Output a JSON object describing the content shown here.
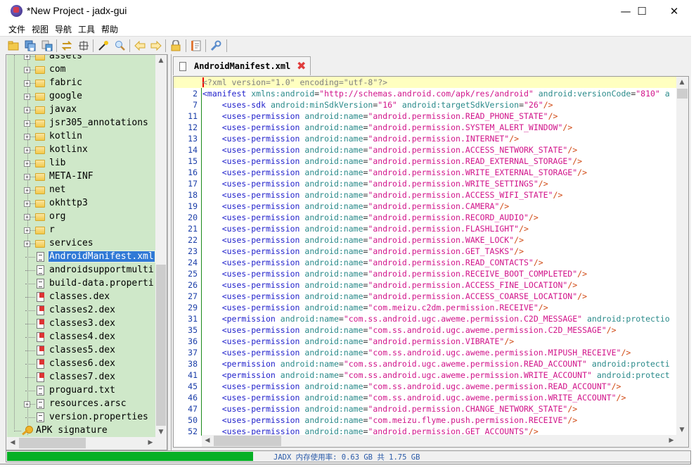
{
  "window": {
    "title": "*New Project - jadx-gui",
    "controls": {
      "minimize": "—",
      "maximize": "☐",
      "close": "✕"
    }
  },
  "menu": [
    "文件",
    "视图",
    "导航",
    "工具",
    "帮助"
  ],
  "toolbar": {
    "groups": [
      [
        "open-file-icon",
        "save-all-icon",
        "export-icon"
      ],
      [
        "sync-tree-icon",
        "flatten-packages-icon"
      ],
      [
        "decompile-all-icon",
        "search-icon"
      ],
      [
        "back-icon",
        "forward-icon"
      ],
      [
        "deobfuscation-icon"
      ],
      [
        "log-viewer-icon"
      ],
      [
        "preferences-icon"
      ]
    ]
  },
  "tree": {
    "items": [
      {
        "label": "assets",
        "type": "folder",
        "expandable": true
      },
      {
        "label": "com",
        "type": "folder",
        "expandable": true
      },
      {
        "label": "fabric",
        "type": "folder",
        "expandable": true
      },
      {
        "label": "google",
        "type": "folder",
        "expandable": true
      },
      {
        "label": "javax",
        "type": "folder",
        "expandable": true
      },
      {
        "label": "jsr305_annotations",
        "type": "folder",
        "expandable": true
      },
      {
        "label": "kotlin",
        "type": "folder",
        "expandable": true
      },
      {
        "label": "kotlinx",
        "type": "folder",
        "expandable": true
      },
      {
        "label": "lib",
        "type": "folder",
        "expandable": true
      },
      {
        "label": "META-INF",
        "type": "folder",
        "expandable": true
      },
      {
        "label": "net",
        "type": "folder",
        "expandable": true
      },
      {
        "label": "okhttp3",
        "type": "folder",
        "expandable": true
      },
      {
        "label": "org",
        "type": "folder",
        "expandable": true
      },
      {
        "label": "r",
        "type": "folder",
        "expandable": true
      },
      {
        "label": "services",
        "type": "folder",
        "expandable": true
      },
      {
        "label": "AndroidManifest.xml",
        "type": "file",
        "expandable": false,
        "selected": true
      },
      {
        "label": "androidsupportmulti",
        "type": "file",
        "expandable": false
      },
      {
        "label": "build-data.properti",
        "type": "file",
        "expandable": false
      },
      {
        "label": "classes.dex",
        "type": "dex",
        "expandable": false
      },
      {
        "label": "classes2.dex",
        "type": "dex",
        "expandable": false
      },
      {
        "label": "classes3.dex",
        "type": "dex",
        "expandable": false
      },
      {
        "label": "classes4.dex",
        "type": "dex",
        "expandable": false
      },
      {
        "label": "classes5.dex",
        "type": "dex",
        "expandable": false
      },
      {
        "label": "classes6.dex",
        "type": "dex",
        "expandable": false
      },
      {
        "label": "classes7.dex",
        "type": "dex",
        "expandable": false
      },
      {
        "label": "proguard.txt",
        "type": "file",
        "expandable": false
      },
      {
        "label": "resources.arsc",
        "type": "file",
        "expandable": true
      },
      {
        "label": "version.properties",
        "type": "file",
        "expandable": false
      }
    ],
    "root_extra": {
      "label": "APK signature",
      "type": "key"
    }
  },
  "editor": {
    "tab_label": "AndroidManifest.xml",
    "lines": [
      {
        "n": "",
        "cur": true,
        "parts": [
          [
            "pi",
            "<?xml version=\"1.0\" encoding=\"utf-8\"?>"
          ]
        ]
      },
      {
        "n": "2",
        "parts": [
          [
            "tag",
            "<manifest"
          ],
          [
            "attr",
            " xmlns:android"
          ],
          [
            "eq",
            "="
          ],
          [
            "val",
            "\"http://schemas.android.com/apk/res/android\""
          ],
          [
            "attr",
            " android:versionCode"
          ],
          [
            "eq",
            "="
          ],
          [
            "val",
            "\"810\""
          ],
          [
            "attr",
            " a"
          ]
        ]
      },
      {
        "n": "7",
        "parts": [
          [
            "tag",
            "    <uses-sdk"
          ],
          [
            "attr",
            " android:minSdkVersion"
          ],
          [
            "eq",
            "="
          ],
          [
            "val",
            "\"16\""
          ],
          [
            "attr",
            " android:targetSdkVersion"
          ],
          [
            "eq",
            "="
          ],
          [
            "val",
            "\"26\""
          ],
          [
            "end",
            "/>"
          ]
        ]
      },
      {
        "n": "11",
        "perm": "android.permission.READ_PHONE_STATE"
      },
      {
        "n": "12",
        "perm": "android.permission.SYSTEM_ALERT_WINDOW"
      },
      {
        "n": "13",
        "perm": "android.permission.INTERNET"
      },
      {
        "n": "14",
        "perm": "android.permission.ACCESS_NETWORK_STATE"
      },
      {
        "n": "15",
        "perm": "android.permission.READ_EXTERNAL_STORAGE"
      },
      {
        "n": "16",
        "perm": "android.permission.WRITE_EXTERNAL_STORAGE"
      },
      {
        "n": "17",
        "perm": "android.permission.WRITE_SETTINGS"
      },
      {
        "n": "18",
        "perm": "android.permission.ACCESS_WIFI_STATE"
      },
      {
        "n": "19",
        "perm": "android.permission.CAMERA"
      },
      {
        "n": "20",
        "perm": "android.permission.RECORD_AUDIO"
      },
      {
        "n": "21",
        "perm": "android.permission.FLASHLIGHT"
      },
      {
        "n": "22",
        "perm": "android.permission.WAKE_LOCK"
      },
      {
        "n": "23",
        "perm": "android.permission.GET_TASKS"
      },
      {
        "n": "24",
        "perm": "android.permission.READ_CONTACTS"
      },
      {
        "n": "25",
        "perm": "android.permission.RECEIVE_BOOT_COMPLETED"
      },
      {
        "n": "26",
        "perm": "android.permission.ACCESS_FINE_LOCATION"
      },
      {
        "n": "27",
        "perm": "android.permission.ACCESS_COARSE_LOCATION"
      },
      {
        "n": "29",
        "perm": "com.meizu.c2dm.permission.RECEIVE"
      },
      {
        "n": "31",
        "parts": [
          [
            "tag",
            "    <permission"
          ],
          [
            "attr",
            " android:name"
          ],
          [
            "eq",
            "="
          ],
          [
            "val",
            "\"com.ss.android.ugc.aweme.permission.C2D_MESSAGE\""
          ],
          [
            "attr",
            " android:protectio"
          ]
        ]
      },
      {
        "n": "35",
        "perm": "com.ss.android.ugc.aweme.permission.C2D_MESSAGE"
      },
      {
        "n": "36",
        "perm": "android.permission.VIBRATE"
      },
      {
        "n": "37",
        "perm": "com.ss.android.ugc.aweme.permission.MIPUSH_RECEIVE"
      },
      {
        "n": "38",
        "parts": [
          [
            "tag",
            "    <permission"
          ],
          [
            "attr",
            " android:name"
          ],
          [
            "eq",
            "="
          ],
          [
            "val",
            "\"com.ss.android.ugc.aweme.permission.READ_ACCOUNT\""
          ],
          [
            "attr",
            " android:protecti"
          ]
        ]
      },
      {
        "n": "41",
        "parts": [
          [
            "tag",
            "    <permission"
          ],
          [
            "attr",
            " android:name"
          ],
          [
            "eq",
            "="
          ],
          [
            "val",
            "\"com.ss.android.ugc.aweme.permission.WRITE_ACCOUNT\""
          ],
          [
            "attr",
            " android:protect"
          ]
        ]
      },
      {
        "n": "45",
        "perm": "com.ss.android.ugc.aweme.permission.READ_ACCOUNT"
      },
      {
        "n": "46",
        "perm": "com.ss.android.ugc.aweme.permission.WRITE_ACCOUNT"
      },
      {
        "n": "47",
        "perm": "android.permission.CHANGE_NETWORK_STATE"
      },
      {
        "n": "50",
        "perm": "com.meizu.flyme.push.permission.RECEIVE"
      },
      {
        "n": "52",
        "perm": "android.permission.GET_ACCOUNTS"
      }
    ]
  },
  "status": {
    "memory_text": "JADX 内存使用率: 0.63 GB 共 1.75 GB",
    "memory_used_fraction": 0.36,
    "progress_color": "#06b025"
  },
  "colors": {
    "tree_bg": "#cfe8c9",
    "selection": "#3079d6",
    "current_line": "#ffffc0"
  }
}
